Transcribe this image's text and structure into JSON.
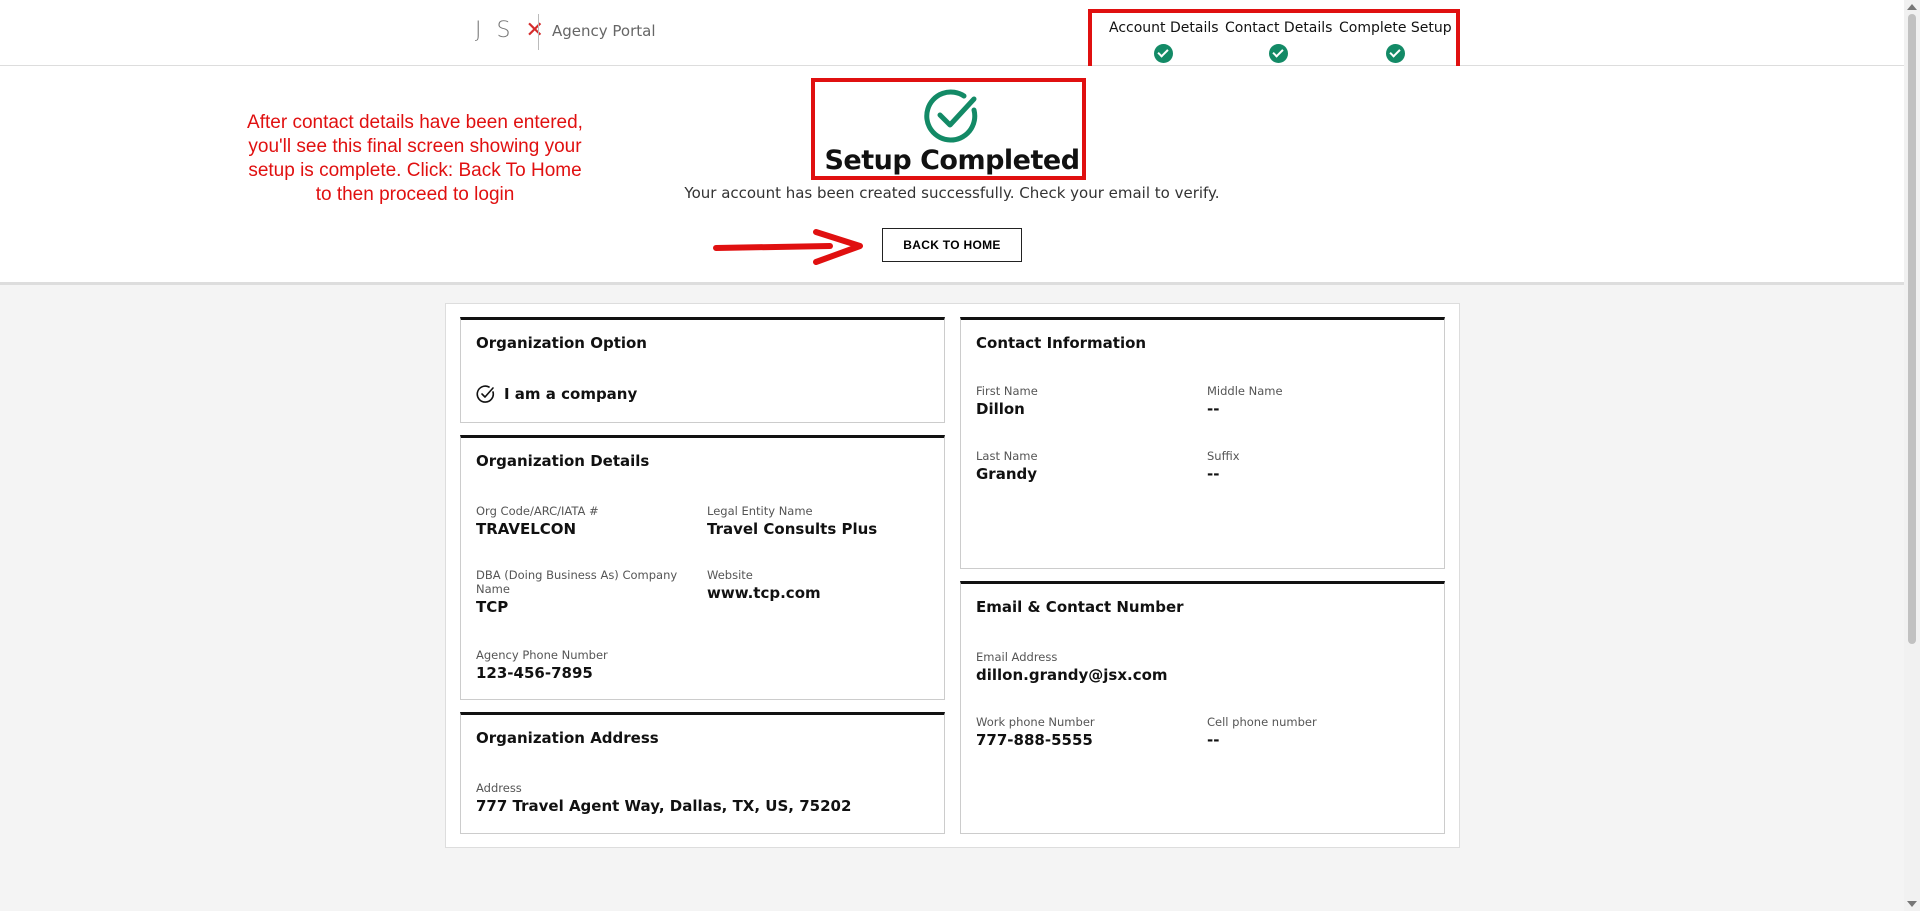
{
  "header": {
    "logo_text": "JSX",
    "portal_label": "Agency Portal",
    "steps": [
      {
        "label": "Account Details"
      },
      {
        "label": "Contact Details"
      },
      {
        "label": "Complete Setup"
      }
    ]
  },
  "hero": {
    "title": "Setup Completed",
    "subtitle": "Your account has been created successfully. Check your email to verify.",
    "back_button": "BACK TO HOME"
  },
  "annotation": {
    "text": "After contact details have been entered, you'll see this final screen showing your setup is complete. Click: Back To Home to then proceed to login"
  },
  "org_option": {
    "title": "Organization Option",
    "selected": "I am a company"
  },
  "org_details": {
    "title": "Organization Details",
    "org_code_label": "Org Code/ARC/IATA #",
    "org_code": "TRAVELCON",
    "legal_name_label": "Legal Entity Name",
    "legal_name": "Travel Consults Plus",
    "dba_label": "DBA (Doing Business As) Company Name",
    "dba": "TCP",
    "website_label": "Website",
    "website": "www.tcp.com",
    "phone_label": "Agency Phone Number",
    "phone": "123-456-7895"
  },
  "org_address": {
    "title": "Organization Address",
    "address_label": "Address",
    "address": "777 Travel Agent Way, Dallas, TX, US, 75202"
  },
  "contact_info": {
    "title": "Contact Information",
    "first_name_label": "First Name",
    "first_name": "Dillon",
    "middle_name_label": "Middle Name",
    "middle_name": "--",
    "last_name_label": "Last Name",
    "last_name": "Grandy",
    "suffix_label": "Suffix",
    "suffix": "--"
  },
  "email_contact": {
    "title": "Email & Contact Number",
    "email_label": "Email Address",
    "email": "dillon.grandy@jsx.com",
    "work_phone_label": "Work phone Number",
    "work_phone": "777-888-5555",
    "cell_phone_label": "Cell phone number",
    "cell_phone": "--"
  },
  "colors": {
    "accent_green": "#138a66",
    "annotation_red": "#e01010",
    "brand_red": "#d52b2b"
  }
}
